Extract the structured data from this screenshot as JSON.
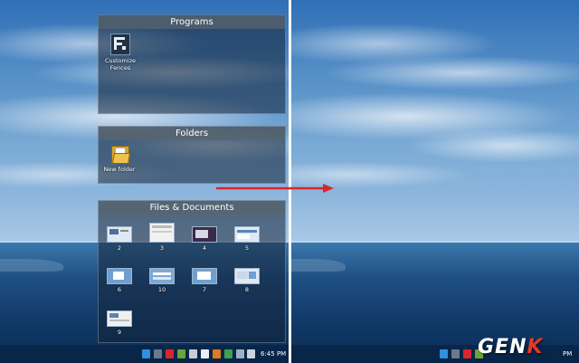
{
  "fences": {
    "programs": {
      "title": "Programs",
      "items": [
        {
          "label": "Customize Fences",
          "icon": "fences-app-icon"
        }
      ]
    },
    "folders": {
      "title": "Folders",
      "items": [
        {
          "label": "New folder",
          "icon": "folder-icon"
        }
      ]
    },
    "files": {
      "title": "Files & Documents",
      "items": [
        {
          "label": "2"
        },
        {
          "label": "3"
        },
        {
          "label": "4"
        },
        {
          "label": "5"
        },
        {
          "label": "6"
        },
        {
          "label": "10"
        },
        {
          "label": "7"
        },
        {
          "label": "8"
        },
        {
          "label": "9"
        }
      ]
    }
  },
  "taskbar": {
    "clock_left": "6:45 PM",
    "clock_right": "PM"
  },
  "logo": {
    "main": "GEN",
    "accent": "K"
  },
  "colors": {
    "arrow": "#d9262c",
    "logo_accent": "#e03a2c"
  }
}
